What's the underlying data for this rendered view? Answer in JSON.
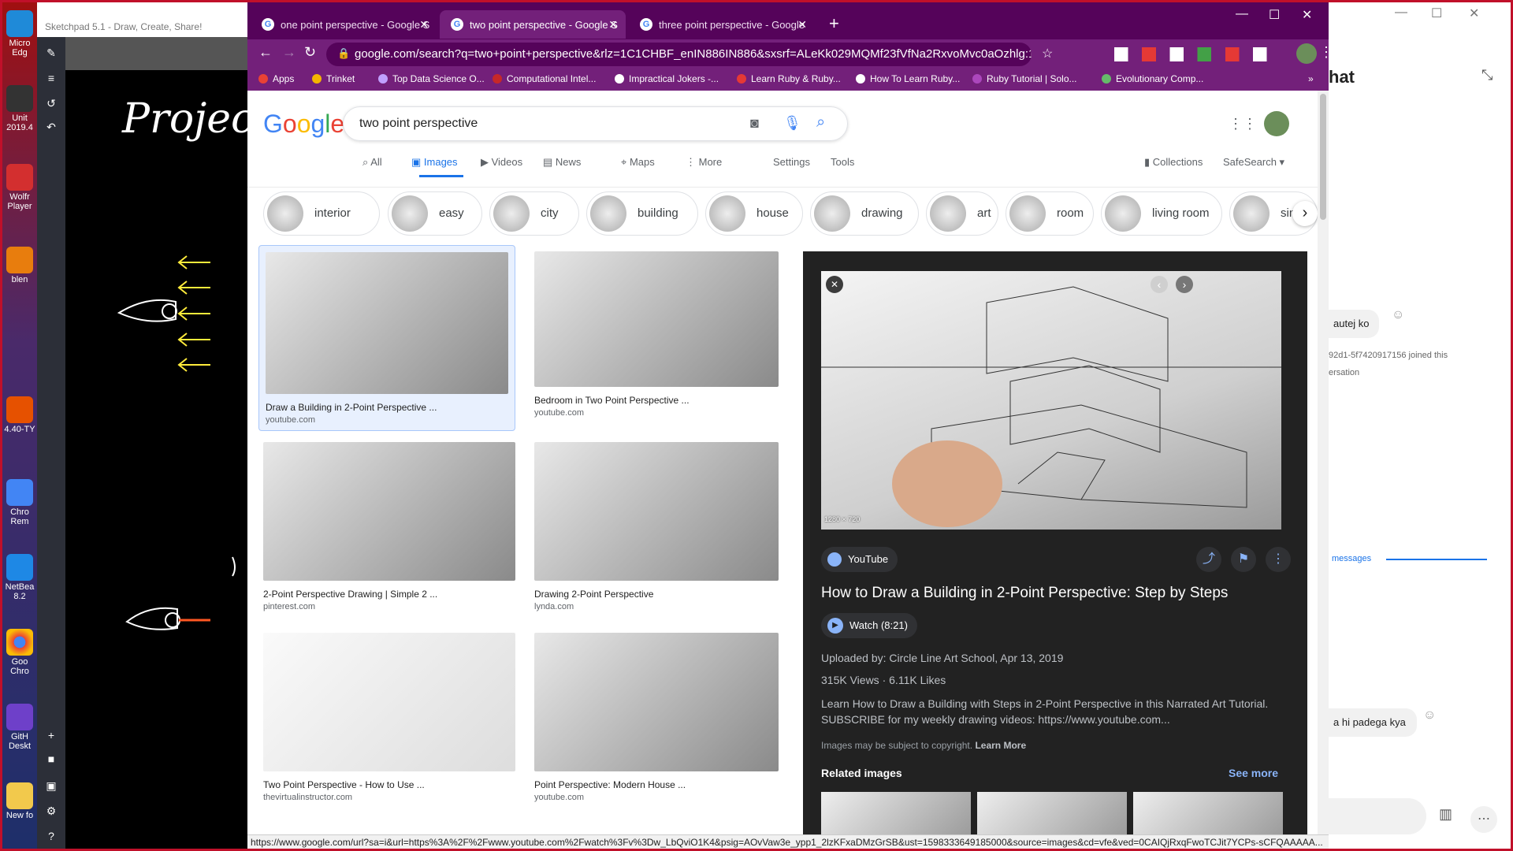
{
  "desktop": {
    "icons": [
      {
        "label": "Micro Edg"
      },
      {
        "label": "Unit 2019.4"
      },
      {
        "label": "Wolfr Player"
      },
      {
        "label": "blen"
      },
      {
        "label": "4.40-TY"
      },
      {
        "label": "Chro Rem"
      },
      {
        "label": "NetBea 8.2"
      },
      {
        "label": "Goo Chro"
      },
      {
        "label": "GitH Deskt"
      },
      {
        "label": "New fo"
      }
    ]
  },
  "sketchpad": {
    "title": "Sketchpad 5.1 - Draw, Create, Share!",
    "canvas_text": "Project"
  },
  "browser": {
    "tabs": [
      {
        "label": "one point perspective - Google S"
      },
      {
        "label": "two point perspective - Google S"
      },
      {
        "label": "three point perspective - Google"
      }
    ],
    "url": "google.com/search?q=two+point+perspective&rlz=1C1CHBF_enIN886IN886&sxsrf=ALeKk029MQMf23fVfNa2RxvoMvc0aOzhlg:159...",
    "bookmarks": [
      {
        "label": "Apps",
        "color": "#e94235"
      },
      {
        "label": "Trinket",
        "color": "#f4b400"
      },
      {
        "label": "Top Data Science O...",
        "color": "#c0a0ff"
      },
      {
        "label": "Computational Intel...",
        "color": "#c62828"
      },
      {
        "label": "Impractical Jokers -...",
        "color": "#ffffff"
      },
      {
        "label": "Learn Ruby & Ruby...",
        "color": "#e53935"
      },
      {
        "label": "How To Learn Ruby...",
        "color": "#ffffff"
      },
      {
        "label": "Ruby Tutorial | Solo...",
        "color": "#ab47bc"
      },
      {
        "label": "Evolutionary Comp...",
        "color": "#66bb6a"
      }
    ],
    "status_url": "https://www.google.com/url?sa=i&url=https%3A%2F%2Fwww.youtube.com%2Fwatch%3Fv%3Dw_LbQviO1K4&psig=AOvVaw3e_ypp1_2lzKFxaDMzGrSB&ust=1598333649185000&source=images&cd=vfe&ved=0CAIQjRxqFwoTCJit7YCPs-sCFQAAAAA..."
  },
  "google": {
    "logo": "Google",
    "query": "two point perspective",
    "nav": [
      "All",
      "Images",
      "Videos",
      "News",
      "Maps",
      "More",
      "Settings",
      "Tools"
    ],
    "collections": "Collections",
    "safesearch": "SafeSearch",
    "chips": [
      "interior",
      "easy",
      "city",
      "building",
      "house",
      "drawing",
      "art",
      "room",
      "living room",
      "simp"
    ],
    "results": [
      {
        "caption": "Draw a Building in 2-Point Perspective ...",
        "source": "youtube.com"
      },
      {
        "caption": "Bedroom in Two Point Perspective ...",
        "source": "youtube.com"
      },
      {
        "caption": "2-Point Perspective Drawing | Simple 2 ...",
        "source": "pinterest.com"
      },
      {
        "caption": "Drawing 2-Point Perspective",
        "source": "lynda.com"
      },
      {
        "caption": "Two Point Perspective - How to Use ...",
        "source": "thevirtualinstructor.com"
      },
      {
        "caption": "Point Perspective: Modern House ...",
        "source": "youtube.com"
      }
    ],
    "panel": {
      "dimensions": "1280 × 720",
      "site": "YouTube",
      "title": "How to Draw a Building in 2-Point Perspective: Step by Steps",
      "watch": "Watch (8:21)",
      "uploaded": "Uploaded by: Circle Line Art School, Apr 13, 2019",
      "views": "315K Views",
      "likes": "6.11K Likes",
      "description": "Learn How to Draw a Building with Steps in 2-Point Perspective in this Narrated Art Tutorial. SUBSCRIBE for my weekly drawing videos: https://www.youtube.com...",
      "copyright": "Images may be subject to copyright.",
      "learn_more": "Learn More",
      "related": "Related images",
      "see_more": "See more"
    }
  },
  "chat": {
    "title": "hat",
    "msg1": "autej ko",
    "join": "92d1-5f7420917156 joined this",
    "join2": "ersation",
    "messages_link": "messages",
    "msg2": "a hi padega kya"
  }
}
